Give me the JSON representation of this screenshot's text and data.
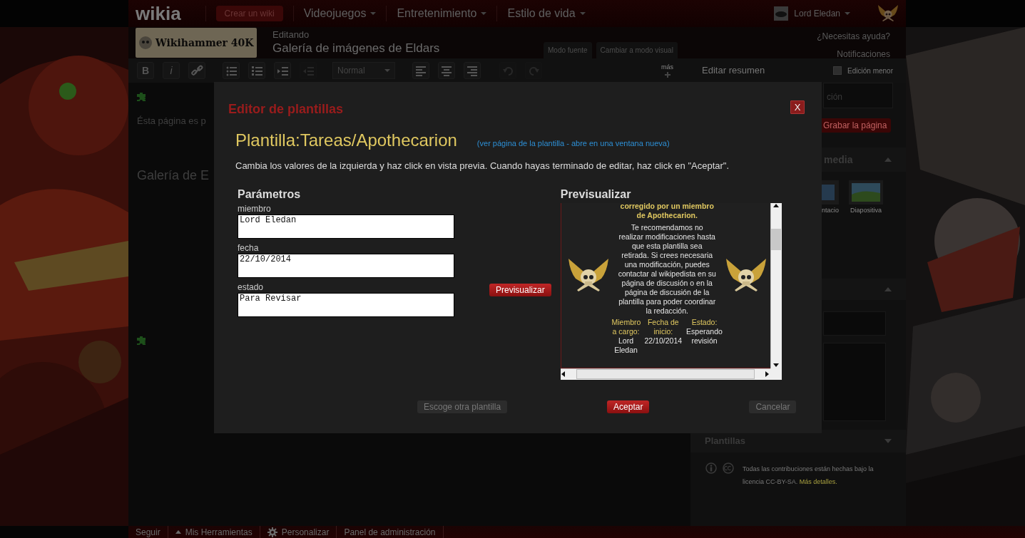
{
  "global_nav": {
    "logo": "wikia",
    "create_button": "Crear un wiki",
    "menus": [
      {
        "label": "Videojuegos"
      },
      {
        "label": "Entretenimiento"
      },
      {
        "label": "Estilo de vida"
      }
    ],
    "user": "Lord Eledan"
  },
  "header": {
    "wiki_logo": "Wikihammer 40K",
    "action": "Editando",
    "page_title": "Galería de imágenes de Eldars",
    "mode_tabs": [
      {
        "label": "Modo fuente"
      },
      {
        "label": "Cambiar a modo visual"
      }
    ],
    "help": "¿Necesitas ayuda?",
    "notifications": "Notificaciones"
  },
  "toolbar": {
    "tools": [
      {
        "kind": "bold",
        "label": "B",
        "disabled": false
      },
      {
        "kind": "italic",
        "label": "i",
        "disabled": false
      },
      {
        "kind": "link",
        "disabled": false
      },
      {
        "kind": "bullets",
        "disabled": false
      },
      {
        "kind": "numbers",
        "disabled": false
      },
      {
        "kind": "indent",
        "disabled": false
      },
      {
        "kind": "outdent",
        "disabled": true
      },
      {
        "kind": "select",
        "label": "Normal"
      },
      {
        "kind": "align-left",
        "disabled": false
      },
      {
        "kind": "align-center",
        "disabled": false
      },
      {
        "kind": "align-right",
        "disabled": false
      },
      {
        "kind": "undo",
        "disabled": true
      },
      {
        "kind": "redo",
        "disabled": true
      }
    ],
    "more": "más",
    "summary_placeholder": "Editar resumen",
    "minor_edit": {
      "label": "Edición menor",
      "checked": false
    }
  },
  "editor": {
    "intro": "Ésta página es p",
    "heading": "Galería de E"
  },
  "sidebar": {
    "summary_value": "ción",
    "save_button": "Grabar la página",
    "media_title": "media",
    "media_items": [
      {
        "label": "ntacio",
        "kind": "slideshow"
      },
      {
        "label": "Diapositiva",
        "kind": "slide"
      }
    ],
    "templates_title": "Plantillas",
    "license": "Todas las contribuciones están hechas bajo la licencia CC-BY-SA.",
    "license_link": "Más detalles."
  },
  "bottom_bar": [
    {
      "label": "Seguir",
      "kind": "plain"
    },
    {
      "label": "Mis Herramientas",
      "kind": "menu"
    },
    {
      "label": "Personalizar",
      "kind": "settings"
    },
    {
      "label": "Panel de administración",
      "kind": "plain"
    }
  ],
  "modal": {
    "title": "Editor de plantillas",
    "close": "X",
    "template_name": "Plantilla:Tareas/Apothecarion",
    "template_link": "(ver página de la plantilla - abre en una ventana nueva)",
    "instructions": "Cambia los valores de la izquierda y haz click en vista previa. Cuando hayas terminado de editar, haz click en \"Aceptar\".",
    "params_title": "Parámetros",
    "params": [
      {
        "label": "miembro",
        "value": "Lord Eledan"
      },
      {
        "label": "fecha",
        "value": "22/10/2014"
      },
      {
        "label": "estado",
        "value": "Para Revisar"
      }
    ],
    "preview_button": "Previsualizar",
    "preview_title": "Previsualizar",
    "preview": {
      "notice": "corregido por un miembro de Apothecarion.",
      "body": "Te recomendamos no realizar modificaciones hasta que esta plantilla sea retirada. Si crees necesaria una modificación, puedes contactar al wikipedista en su página de discusión o en la página de discusión de la plantilla para poder coordinar la redacción.",
      "fields": [
        {
          "label": "Miembro a cargo:",
          "value": "Lord Eledan"
        },
        {
          "label": "Fecha de inicio:",
          "value": "22/10/2014"
        },
        {
          "label": "Estado:",
          "value": "Esperando revisión"
        }
      ]
    },
    "buttons": [
      {
        "label": "Escoge otra plantilla",
        "disabled": true
      },
      {
        "label": "Aceptar",
        "disabled": false
      },
      {
        "label": "Cancelar",
        "disabled": true
      }
    ]
  }
}
